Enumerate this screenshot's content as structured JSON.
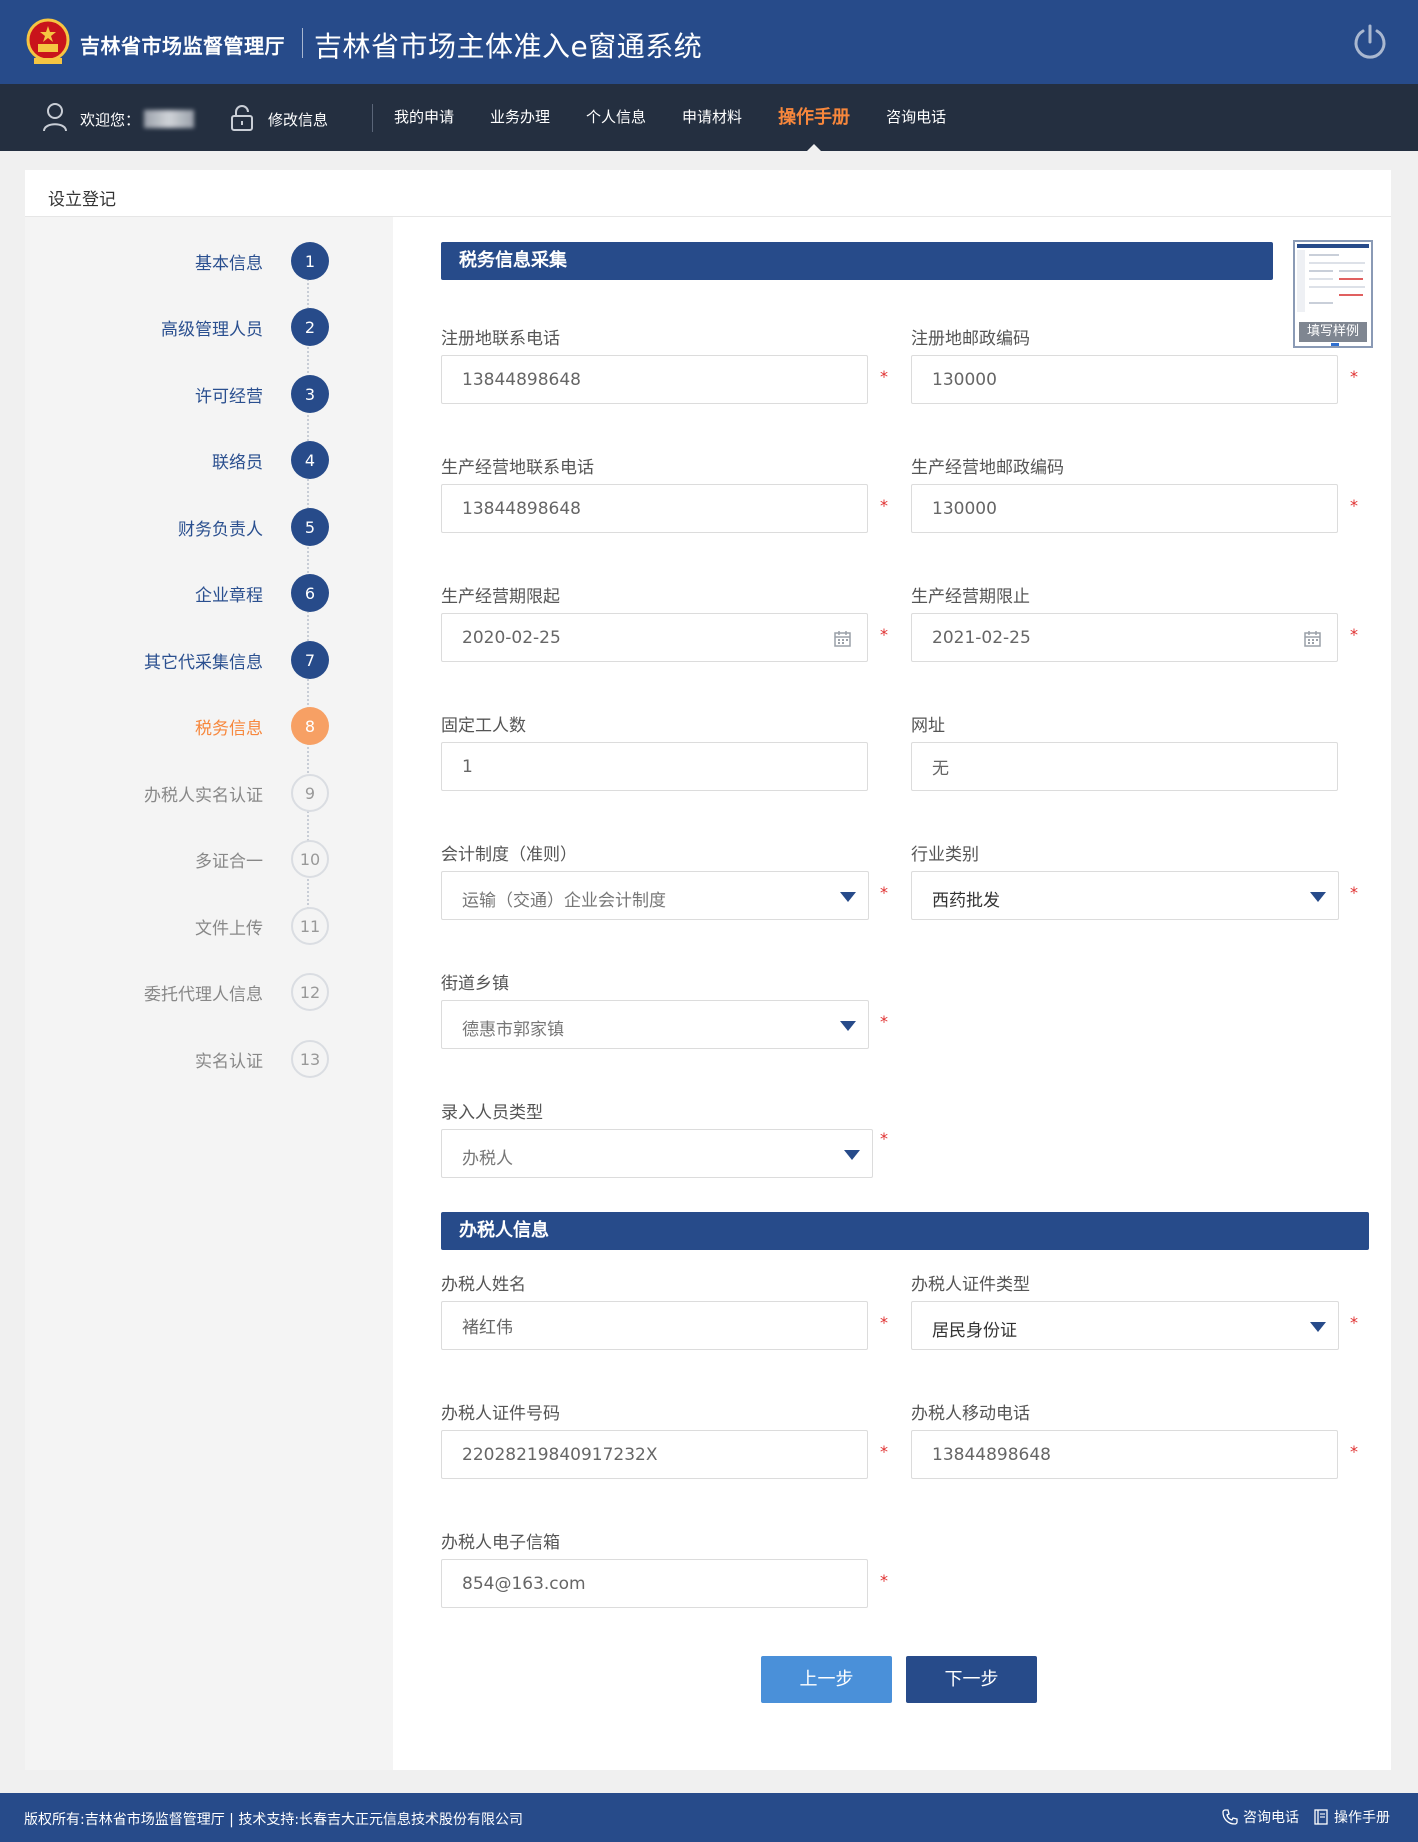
{
  "header": {
    "org_name": "吉林省市场监督管理厅",
    "system_title": "吉林省市场主体准入e窗通系统"
  },
  "nav": {
    "welcome": "欢迎您：",
    "edit_info": "修改信息",
    "links": [
      "我的申请",
      "业务办理",
      "个人信息",
      "申请材料",
      "操作手册",
      "咨询电话"
    ],
    "active_link": "操作手册"
  },
  "panel": {
    "title": "设立登记"
  },
  "steps": [
    {
      "num": "1",
      "label": "基本信息",
      "state": "done"
    },
    {
      "num": "2",
      "label": "高级管理人员",
      "state": "done"
    },
    {
      "num": "3",
      "label": "许可经营",
      "state": "done"
    },
    {
      "num": "4",
      "label": "联络员",
      "state": "done"
    },
    {
      "num": "5",
      "label": "财务负责人",
      "state": "done"
    },
    {
      "num": "6",
      "label": "企业章程",
      "state": "done"
    },
    {
      "num": "7",
      "label": "其它代采集信息",
      "state": "done"
    },
    {
      "num": "8",
      "label": "税务信息",
      "state": "current"
    },
    {
      "num": "9",
      "label": "办税人实名认证",
      "state": "pending"
    },
    {
      "num": "10",
      "label": "多证合一",
      "state": "pending"
    },
    {
      "num": "11",
      "label": "文件上传",
      "state": "pending"
    },
    {
      "num": "12",
      "label": "委托代理人信息",
      "state": "pending"
    },
    {
      "num": "13",
      "label": "实名认证",
      "state": "pending"
    }
  ],
  "tax_section": {
    "title": "税务信息采集",
    "sample_label": "填写样例",
    "reg_phone": {
      "label": "注册地联系电话",
      "value": "13844898648"
    },
    "reg_postcode": {
      "label": "注册地邮政编码",
      "value": "130000"
    },
    "biz_phone": {
      "label": "生产经营地联系电话",
      "value": "13844898648"
    },
    "biz_postcode": {
      "label": "生产经营地邮政编码",
      "value": "130000"
    },
    "period_start": {
      "label": "生产经营期限起",
      "value": "2020-02-25"
    },
    "period_end": {
      "label": "生产经营期限止",
      "value": "2021-02-25"
    },
    "fixed_workers": {
      "label": "固定工人数",
      "value": "1"
    },
    "website": {
      "label": "网址",
      "value": "无"
    },
    "accounting": {
      "label": "会计制度（准则）",
      "value": "运输（交通）企业会计制度"
    },
    "industry": {
      "label": "行业类别",
      "value": "西药批发"
    },
    "street": {
      "label": "街道乡镇",
      "value": "德惠市郭家镇"
    },
    "entry_type": {
      "label": "录入人员类型",
      "value": "办税人"
    }
  },
  "taxpayer_section": {
    "title": "办税人信息",
    "name": {
      "label": "办税人姓名",
      "value": "褚红伟"
    },
    "id_type": {
      "label": "办税人证件类型",
      "value": "居民身份证"
    },
    "id_number": {
      "label": "办税人证件号码",
      "value": "22028219840917232X"
    },
    "mobile": {
      "label": "办税人移动电话",
      "value": "13844898648"
    },
    "email": {
      "label": "办税人电子信箱",
      "value": "854@163.com"
    }
  },
  "buttons": {
    "prev": "上一步",
    "next": "下一步"
  },
  "footer": {
    "copyright": "版权所有:吉林省市场监督管理厅 | 技术支持:长春吉大正元信息技术股份有限公司",
    "hotline": "咨询电话",
    "manual": "操作手册"
  },
  "required_mark": "*",
  "colors": {
    "primary": "#274b8a",
    "nav_bg": "#242f40",
    "accent": "#f7873c",
    "required": "#e03030"
  }
}
